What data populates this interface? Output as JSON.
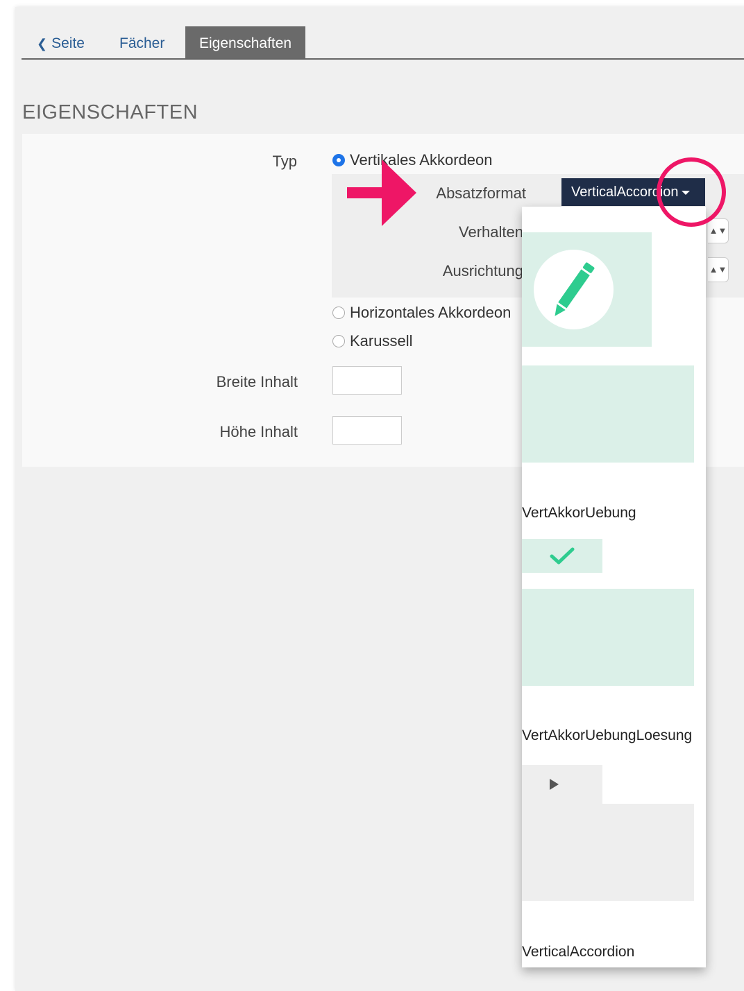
{
  "tabs": {
    "back": "Seite",
    "second": "Fächer",
    "active": "Eigenschaften"
  },
  "section_title": "EIGENSCHAFTEN",
  "form": {
    "typ_label": "Typ",
    "options": {
      "vertical": "Vertikales Akkordeon",
      "horizontal": "Horizontales Akkordeon",
      "carousel": "Karussell"
    },
    "absatzformat_label": "Absatzformat",
    "absatzformat_value": "VerticalAccordion",
    "verhalten_label": "Verhalten",
    "ausrichtung_label": "Ausrichtung",
    "breite_label": "Breite Inhalt",
    "breite_value": "",
    "hoehe_label": "Höhe Inhalt",
    "hoehe_value": ""
  },
  "dropdown_items": [
    "VertAkkorUebung",
    "VertAkkorUebungLoesung",
    "VerticalAccordion"
  ],
  "colors": {
    "accent": "#1f2d48",
    "highlight": "#ee1666",
    "swatch_green": "#dbf0e8",
    "icon_green": "#2ecc8f",
    "swatch_gray": "#eeeeee"
  }
}
